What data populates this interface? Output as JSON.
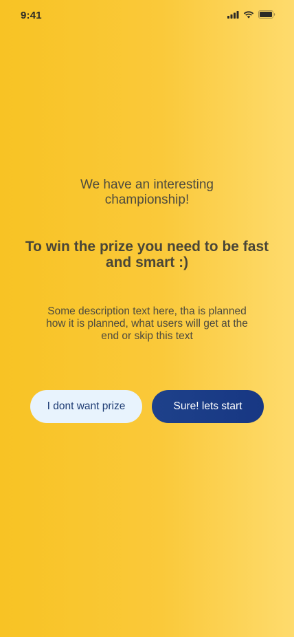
{
  "status_bar": {
    "time": "9:41",
    "icons": [
      "cellular-signal-icon",
      "wifi-icon",
      "battery-icon"
    ]
  },
  "colors": {
    "background_start": "#f8c324",
    "background_end": "#fedb6d",
    "primary_button": "#1e418a",
    "secondary_button": "#e8f3fd",
    "text": "#4a4637"
  },
  "main": {
    "intro_title": "We have an interesting championship!",
    "headline": "To win the prize you need to be fast and smart :)",
    "description": "Some description text here, tha is planned how it is planned, what users will get at the end or skip this text"
  },
  "actions": {
    "decline_label": "I dont want prize",
    "start_label": "Sure! lets start"
  }
}
